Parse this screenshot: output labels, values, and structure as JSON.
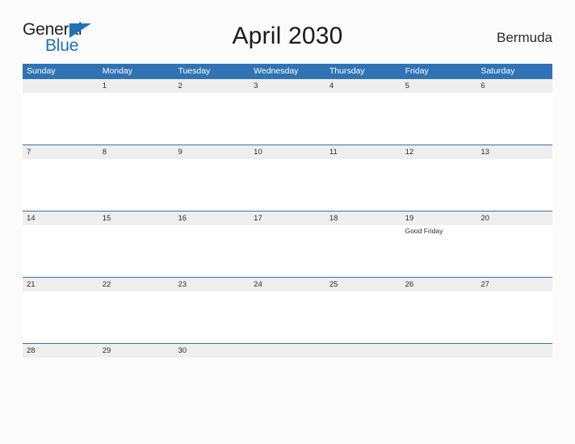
{
  "branding": {
    "logo_text_primary": "General",
    "logo_text_secondary": "Blue",
    "logo_icon": "triangle-flag-icon",
    "primary_color": "#2f73b4",
    "logo_blue": "#1d72b8"
  },
  "header": {
    "title": "April 2030",
    "country": "Bermuda"
  },
  "calendar": {
    "weekday_headers": [
      "Sunday",
      "Monday",
      "Tuesday",
      "Wednesday",
      "Thursday",
      "Friday",
      "Saturday"
    ],
    "weeks": [
      {
        "days": [
          {
            "date": "",
            "events": []
          },
          {
            "date": "1",
            "events": []
          },
          {
            "date": "2",
            "events": []
          },
          {
            "date": "3",
            "events": []
          },
          {
            "date": "4",
            "events": []
          },
          {
            "date": "5",
            "events": []
          },
          {
            "date": "6",
            "events": []
          }
        ]
      },
      {
        "days": [
          {
            "date": "7",
            "events": []
          },
          {
            "date": "8",
            "events": []
          },
          {
            "date": "9",
            "events": []
          },
          {
            "date": "10",
            "events": []
          },
          {
            "date": "11",
            "events": []
          },
          {
            "date": "12",
            "events": []
          },
          {
            "date": "13",
            "events": []
          }
        ]
      },
      {
        "days": [
          {
            "date": "14",
            "events": []
          },
          {
            "date": "15",
            "events": []
          },
          {
            "date": "16",
            "events": []
          },
          {
            "date": "17",
            "events": []
          },
          {
            "date": "18",
            "events": []
          },
          {
            "date": "19",
            "events": [
              "Good Friday"
            ]
          },
          {
            "date": "20",
            "events": []
          }
        ]
      },
      {
        "days": [
          {
            "date": "21",
            "events": []
          },
          {
            "date": "22",
            "events": []
          },
          {
            "date": "23",
            "events": []
          },
          {
            "date": "24",
            "events": []
          },
          {
            "date": "25",
            "events": []
          },
          {
            "date": "26",
            "events": []
          },
          {
            "date": "27",
            "events": []
          }
        ]
      },
      {
        "days": [
          {
            "date": "28",
            "events": []
          },
          {
            "date": "29",
            "events": []
          },
          {
            "date": "30",
            "events": []
          },
          {
            "date": "",
            "events": []
          },
          {
            "date": "",
            "events": []
          },
          {
            "date": "",
            "events": []
          },
          {
            "date": "",
            "events": []
          }
        ]
      }
    ]
  }
}
